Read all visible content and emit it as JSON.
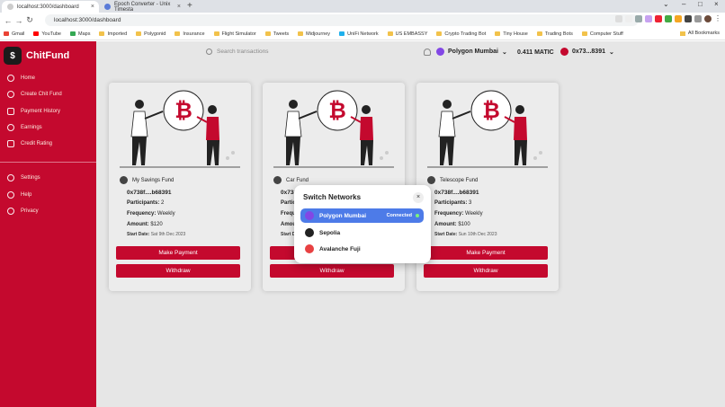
{
  "browser": {
    "tabs": [
      {
        "title": "localhost:3000/dashboard",
        "active": true
      },
      {
        "title": "Epoch Converter - Unix Timesta",
        "active": false
      }
    ],
    "url": "localhost:3000/dashboard",
    "bookmarks": [
      "Gmail",
      "YouTube",
      "Maps",
      "Imported",
      "Polygonid",
      "Insurance",
      "Flight Simulator",
      "Tweets",
      "Midjourney",
      "UniFi Network",
      "US EMBASSY",
      "Crypto Trading Bot",
      "Tiny House",
      "Trading Bots",
      "Computer Stuff"
    ],
    "all_bookmarks": "All Bookmarks"
  },
  "app": {
    "name": "ChitFund",
    "logo_glyph": "$",
    "nav_primary": [
      "Home",
      "Create Chit Fund",
      "Payment History",
      "Earnings",
      "Credit Rating"
    ],
    "nav_secondary": [
      "Settings",
      "Help",
      "Privacy"
    ],
    "search_placeholder": "Search transactions",
    "network_label": "Polygon Mumbai",
    "balance": "0.411 MATIC",
    "account": "0x73...8391"
  },
  "cards": [
    {
      "name": "My Savings Fund",
      "address": "0x738f....b68391",
      "participants_label": "Participants:",
      "participants": "2",
      "frequency_label": "Frequency:",
      "frequency": "Weekly",
      "amount_label": "Amount:",
      "amount": "$120",
      "start_label": "Start Date:",
      "start_date": "Sat 9th Dec 2023",
      "pay_label": "Make Payment",
      "withdraw_label": "Withdraw"
    },
    {
      "name": "Car Fund",
      "address": "0x738f....b68391",
      "participants_label": "Participants:",
      "participants": "",
      "frequency_label": "Frequency:",
      "frequency": "",
      "amount_label": "Amount:",
      "amount": "",
      "start_label": "Start Date:",
      "start_date": "",
      "pay_label": "Make Payment",
      "withdraw_label": "Withdraw"
    },
    {
      "name": "Telescope Fund",
      "address": "0x738f....b68391",
      "participants_label": "Participants:",
      "participants": "3",
      "frequency_label": "Frequency:",
      "frequency": "Weekly",
      "amount_label": "Amount:",
      "amount": "$100",
      "start_label": "Start Date:",
      "start_date": "Sun 10th Dec 2023",
      "pay_label": "Make Payment",
      "withdraw_label": "Withdraw"
    }
  ],
  "modal": {
    "title": "Switch Networks",
    "close": "×",
    "connected_label": "Connected",
    "networks": [
      {
        "name": "Polygon Mumbai",
        "selected": true,
        "color": "#8247e5"
      },
      {
        "name": "Sepolia",
        "selected": false,
        "color": "#222222"
      },
      {
        "name": "Avalanche Fuji",
        "selected": false,
        "color": "#e84142"
      }
    ]
  },
  "colors": {
    "brand": "#c4092e",
    "selected_network": "#4d7be8",
    "polygon": "#8247e5"
  }
}
